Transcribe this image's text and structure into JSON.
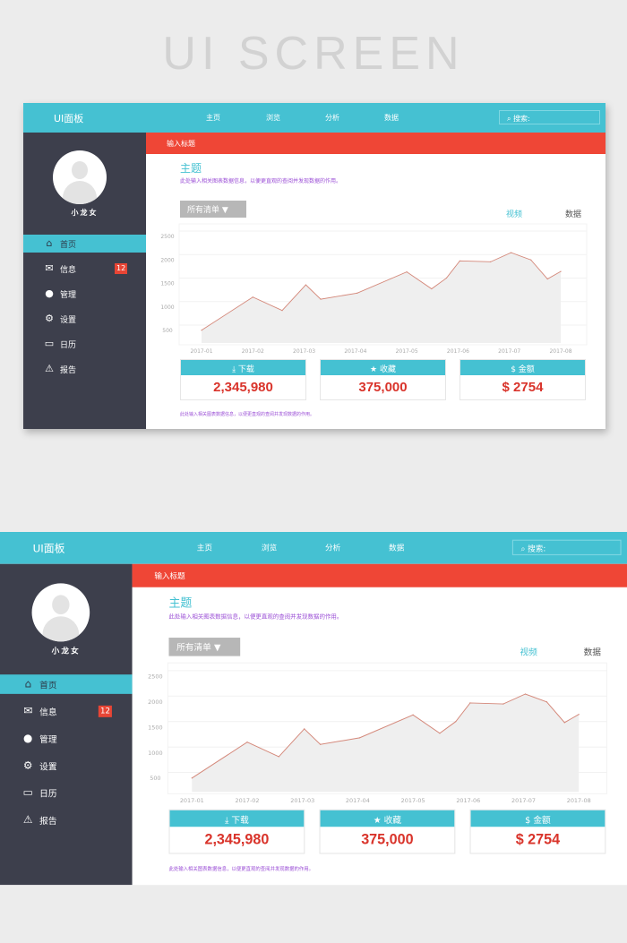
{
  "heading": "UI SCREEN",
  "app": {
    "logo": "UI面板",
    "nav": [
      "主页",
      "浏览",
      "分析",
      "数据"
    ],
    "search_placeholder": "搜索:",
    "user_name": "小龙女",
    "menu": [
      {
        "label": "首页",
        "icon": "home-icon",
        "glyph": "⌂",
        "active": true
      },
      {
        "label": "信息",
        "icon": "mail-icon",
        "glyph": "✉",
        "badge": "12"
      },
      {
        "label": "管理",
        "icon": "user-icon",
        "glyph": "●"
      },
      {
        "label": "设置",
        "icon": "gear-icon",
        "glyph": "⚙"
      },
      {
        "label": "日历",
        "icon": "calendar-icon",
        "glyph": "▭"
      },
      {
        "label": "报告",
        "icon": "warning-icon",
        "glyph": "⚠"
      }
    ],
    "banner": "输入标题",
    "title": "主题",
    "subtitle": "此处输入相关图表数据信息，以便更直观的查阅并发现数据的作用。",
    "dropdown": "所有清单 ▼",
    "tabs": [
      {
        "label": "视频",
        "active": true
      },
      {
        "label": "数据",
        "active": false
      }
    ],
    "cards": [
      {
        "label": "下载",
        "icon": "download-icon",
        "glyph": "⤓",
        "value": "2,345,980"
      },
      {
        "label": "收藏",
        "icon": "star-icon",
        "glyph": "★",
        "value": "375,000"
      },
      {
        "label": "金额",
        "icon": "dollar-icon",
        "glyph": "$",
        "value": "$ 2754"
      }
    ],
    "footnote": "此处输入相关图表数据信息，以便更直观的查阅并发现数据的作用。"
  },
  "colors": {
    "accent": "#45c1d2",
    "banner": "#ef4636",
    "sidebar": "#3d3f4c",
    "value": "#d9342b",
    "line": "#d4887a",
    "area": "#efefef",
    "subtitle": "#9b4fd6"
  },
  "chart_data": {
    "type": "area",
    "x_ticks": [
      "2017-01",
      "2017-02",
      "2017-03",
      "2017-04",
      "2017-05",
      "2017-06",
      "2017-07",
      "2017-08"
    ],
    "y_ticks": [
      2500,
      2000,
      1500,
      1000,
      500
    ],
    "ylim": [
      500,
      2500
    ],
    "grid": true,
    "points": [
      {
        "x": "2017-01-01",
        "y": 505
      },
      {
        "x": "2017-02-01",
        "y": 1210
      },
      {
        "x": "2017-02-17",
        "y": 925
      },
      {
        "x": "2017-03-02",
        "y": 1470
      },
      {
        "x": "2017-03-11",
        "y": 1165
      },
      {
        "x": "2017-04-02",
        "y": 1295
      },
      {
        "x": "2017-05-01",
        "y": 1745
      },
      {
        "x": "2017-05-16",
        "y": 1385
      },
      {
        "x": "2017-05-25",
        "y": 1615
      },
      {
        "x": "2017-06-02",
        "y": 1980
      },
      {
        "x": "2017-06-20",
        "y": 1960
      },
      {
        "x": "2017-07-02",
        "y": 2155
      },
      {
        "x": "2017-07-14",
        "y": 2000
      },
      {
        "x": "2017-07-24",
        "y": 1595
      },
      {
        "x": "2017-08-01",
        "y": 1755
      }
    ]
  }
}
